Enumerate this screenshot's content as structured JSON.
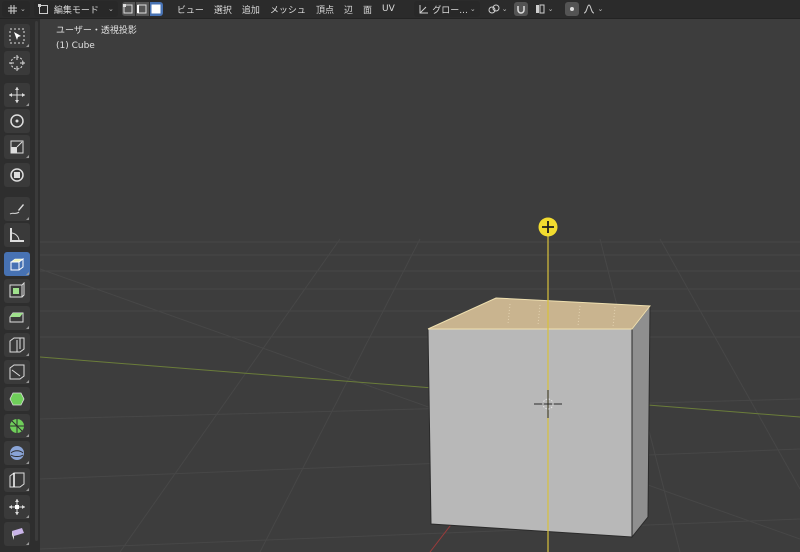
{
  "header": {
    "mode_label": "編集モード",
    "menus": [
      "ビュー",
      "選択",
      "追加",
      "メッシュ",
      "頂点",
      "辺",
      "面",
      "UV"
    ],
    "transform_orientation": "グロー..."
  },
  "viewport": {
    "view_name": "ユーザー・透視投影",
    "object_info": "(1) Cube"
  },
  "toolbar": {
    "tools": [
      {
        "name": "select-box",
        "icon": "cursor-icon",
        "active": false
      },
      {
        "name": "cursor",
        "icon": "crosshair-icon",
        "active": false
      },
      {
        "name": "move",
        "icon": "move-icon",
        "active": false
      },
      {
        "name": "rotate",
        "icon": "rotate-icon",
        "active": false
      },
      {
        "name": "scale",
        "icon": "scale-icon",
        "active": false
      },
      {
        "name": "transform",
        "icon": "transform-icon",
        "active": false
      },
      {
        "name": "annotate",
        "icon": "pencil-icon",
        "active": false
      },
      {
        "name": "measure",
        "icon": "ruler-icon",
        "active": false
      },
      {
        "name": "extrude",
        "icon": "extrude-icon",
        "active": true
      },
      {
        "name": "inset",
        "icon": "inset-icon",
        "active": false
      },
      {
        "name": "bevel",
        "icon": "bevel-icon",
        "active": false
      },
      {
        "name": "loop-cut",
        "icon": "loopcut-icon",
        "active": false
      },
      {
        "name": "knife",
        "icon": "knife-icon",
        "active": false
      },
      {
        "name": "poly-build",
        "icon": "polybuild-icon",
        "active": false
      },
      {
        "name": "spin",
        "icon": "spin-icon",
        "active": false
      },
      {
        "name": "smooth",
        "icon": "smooth-icon",
        "active": false
      },
      {
        "name": "edge-slide",
        "icon": "edgeslide-icon",
        "active": false
      },
      {
        "name": "shrink-fatten",
        "icon": "shrink-icon",
        "active": false
      },
      {
        "name": "shear",
        "icon": "shear-icon",
        "active": false
      }
    ]
  },
  "colors": {
    "accent": "#4772b3",
    "gizmo": "#e8d34a",
    "face_selected": "#c9b48f",
    "cube_face": "#b8b8b8"
  }
}
